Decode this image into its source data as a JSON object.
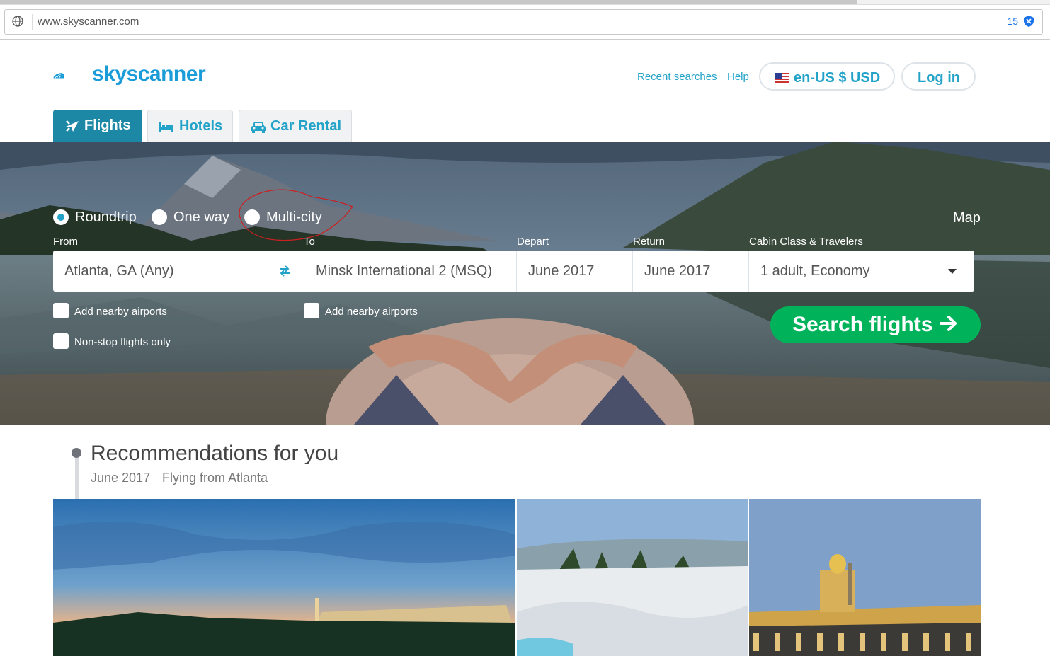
{
  "browser": {
    "url": "www.skyscanner.com",
    "extension_count": "15"
  },
  "header": {
    "brand": "skyscanner",
    "recent_searches": "Recent searches",
    "help": "Help",
    "locale": "en-US $ USD",
    "login": "Log in"
  },
  "verticals": [
    {
      "label": "Flights",
      "icon": "plane-icon",
      "active": true
    },
    {
      "label": "Hotels",
      "icon": "bed-icon",
      "active": false
    },
    {
      "label": "Car Rental",
      "icon": "car-icon",
      "active": false
    }
  ],
  "search": {
    "trip_types": [
      {
        "label": "Roundtrip",
        "selected": true
      },
      {
        "label": "One way",
        "selected": false
      },
      {
        "label": "Multi-city",
        "selected": false
      }
    ],
    "map_link": "Map",
    "fields": {
      "from": {
        "label": "From",
        "value": "Atlanta, GA (Any)"
      },
      "to": {
        "label": "To",
        "value": "Minsk International 2 (MSQ)"
      },
      "depart": {
        "label": "Depart",
        "value": "June 2017"
      },
      "return": {
        "label": "Return",
        "value": "June 2017"
      },
      "cabin": {
        "label": "Cabin Class & Travelers",
        "value": "1 adult, Economy"
      }
    },
    "nearby_from": "Add nearby airports",
    "nearby_to": "Add nearby airports",
    "nonstop": "Non-stop flights only",
    "submit": "Search flights"
  },
  "recommendations": {
    "title": "Recommendations for you",
    "month": "June 2017",
    "origin": "Flying from Atlanta"
  },
  "colors": {
    "brand": "#24a3c8",
    "tab_active": "#1c88a6",
    "search_button": "#00b35b",
    "annotation": "#cc1f1f"
  }
}
